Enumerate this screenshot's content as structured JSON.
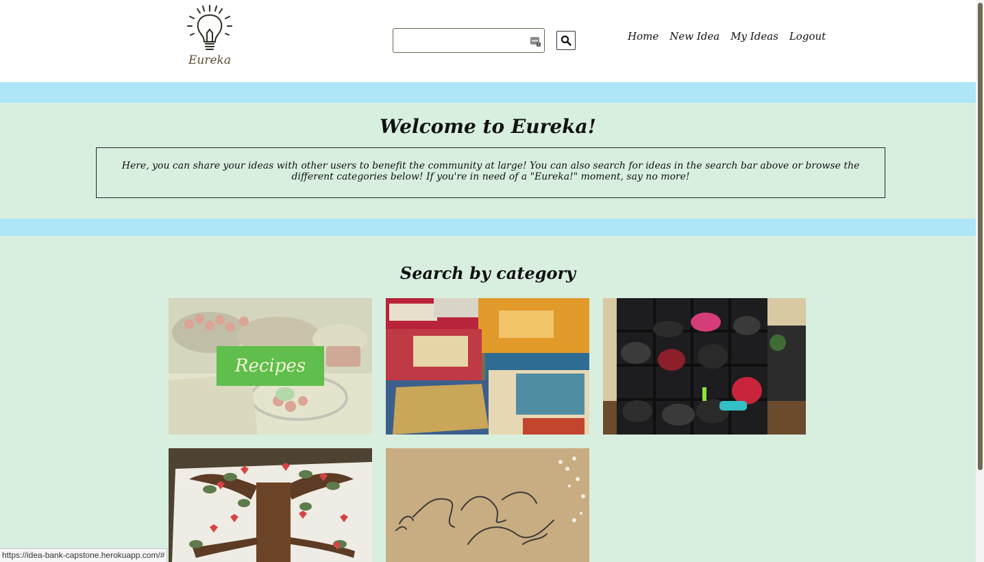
{
  "header": {
    "logo_text": "Eureka",
    "search": {
      "value": "",
      "placeholder": ""
    },
    "nav": [
      "Home",
      "New Idea",
      "My Ideas",
      "Logout"
    ]
  },
  "welcome": {
    "title": "Welcome to Eureka!",
    "intro": "Here, you can share your ideas with other users to benefit the community at large! You can also search for ideas in the search bar above or browse the different categories below! If you're in need of a \"Eureka!\" moment, say no more!"
  },
  "categories": {
    "title": "Search by category",
    "tiles": [
      {
        "label": "Recipes",
        "image": "food-platter"
      },
      {
        "label": "",
        "image": "board-games"
      },
      {
        "label": "",
        "image": "backpacks-shelf"
      },
      {
        "label": "",
        "image": "paper-tree-craft"
      },
      {
        "label": "",
        "image": "calligraphy"
      }
    ]
  },
  "status_url": "https://idea-bank-capstone.herokuapp.com/#",
  "colors": {
    "page_bg": "#d8efe0",
    "band": "#aee6f7",
    "label_bg": "#5fbe4c",
    "scroll_thumb": "#6f6a52"
  }
}
